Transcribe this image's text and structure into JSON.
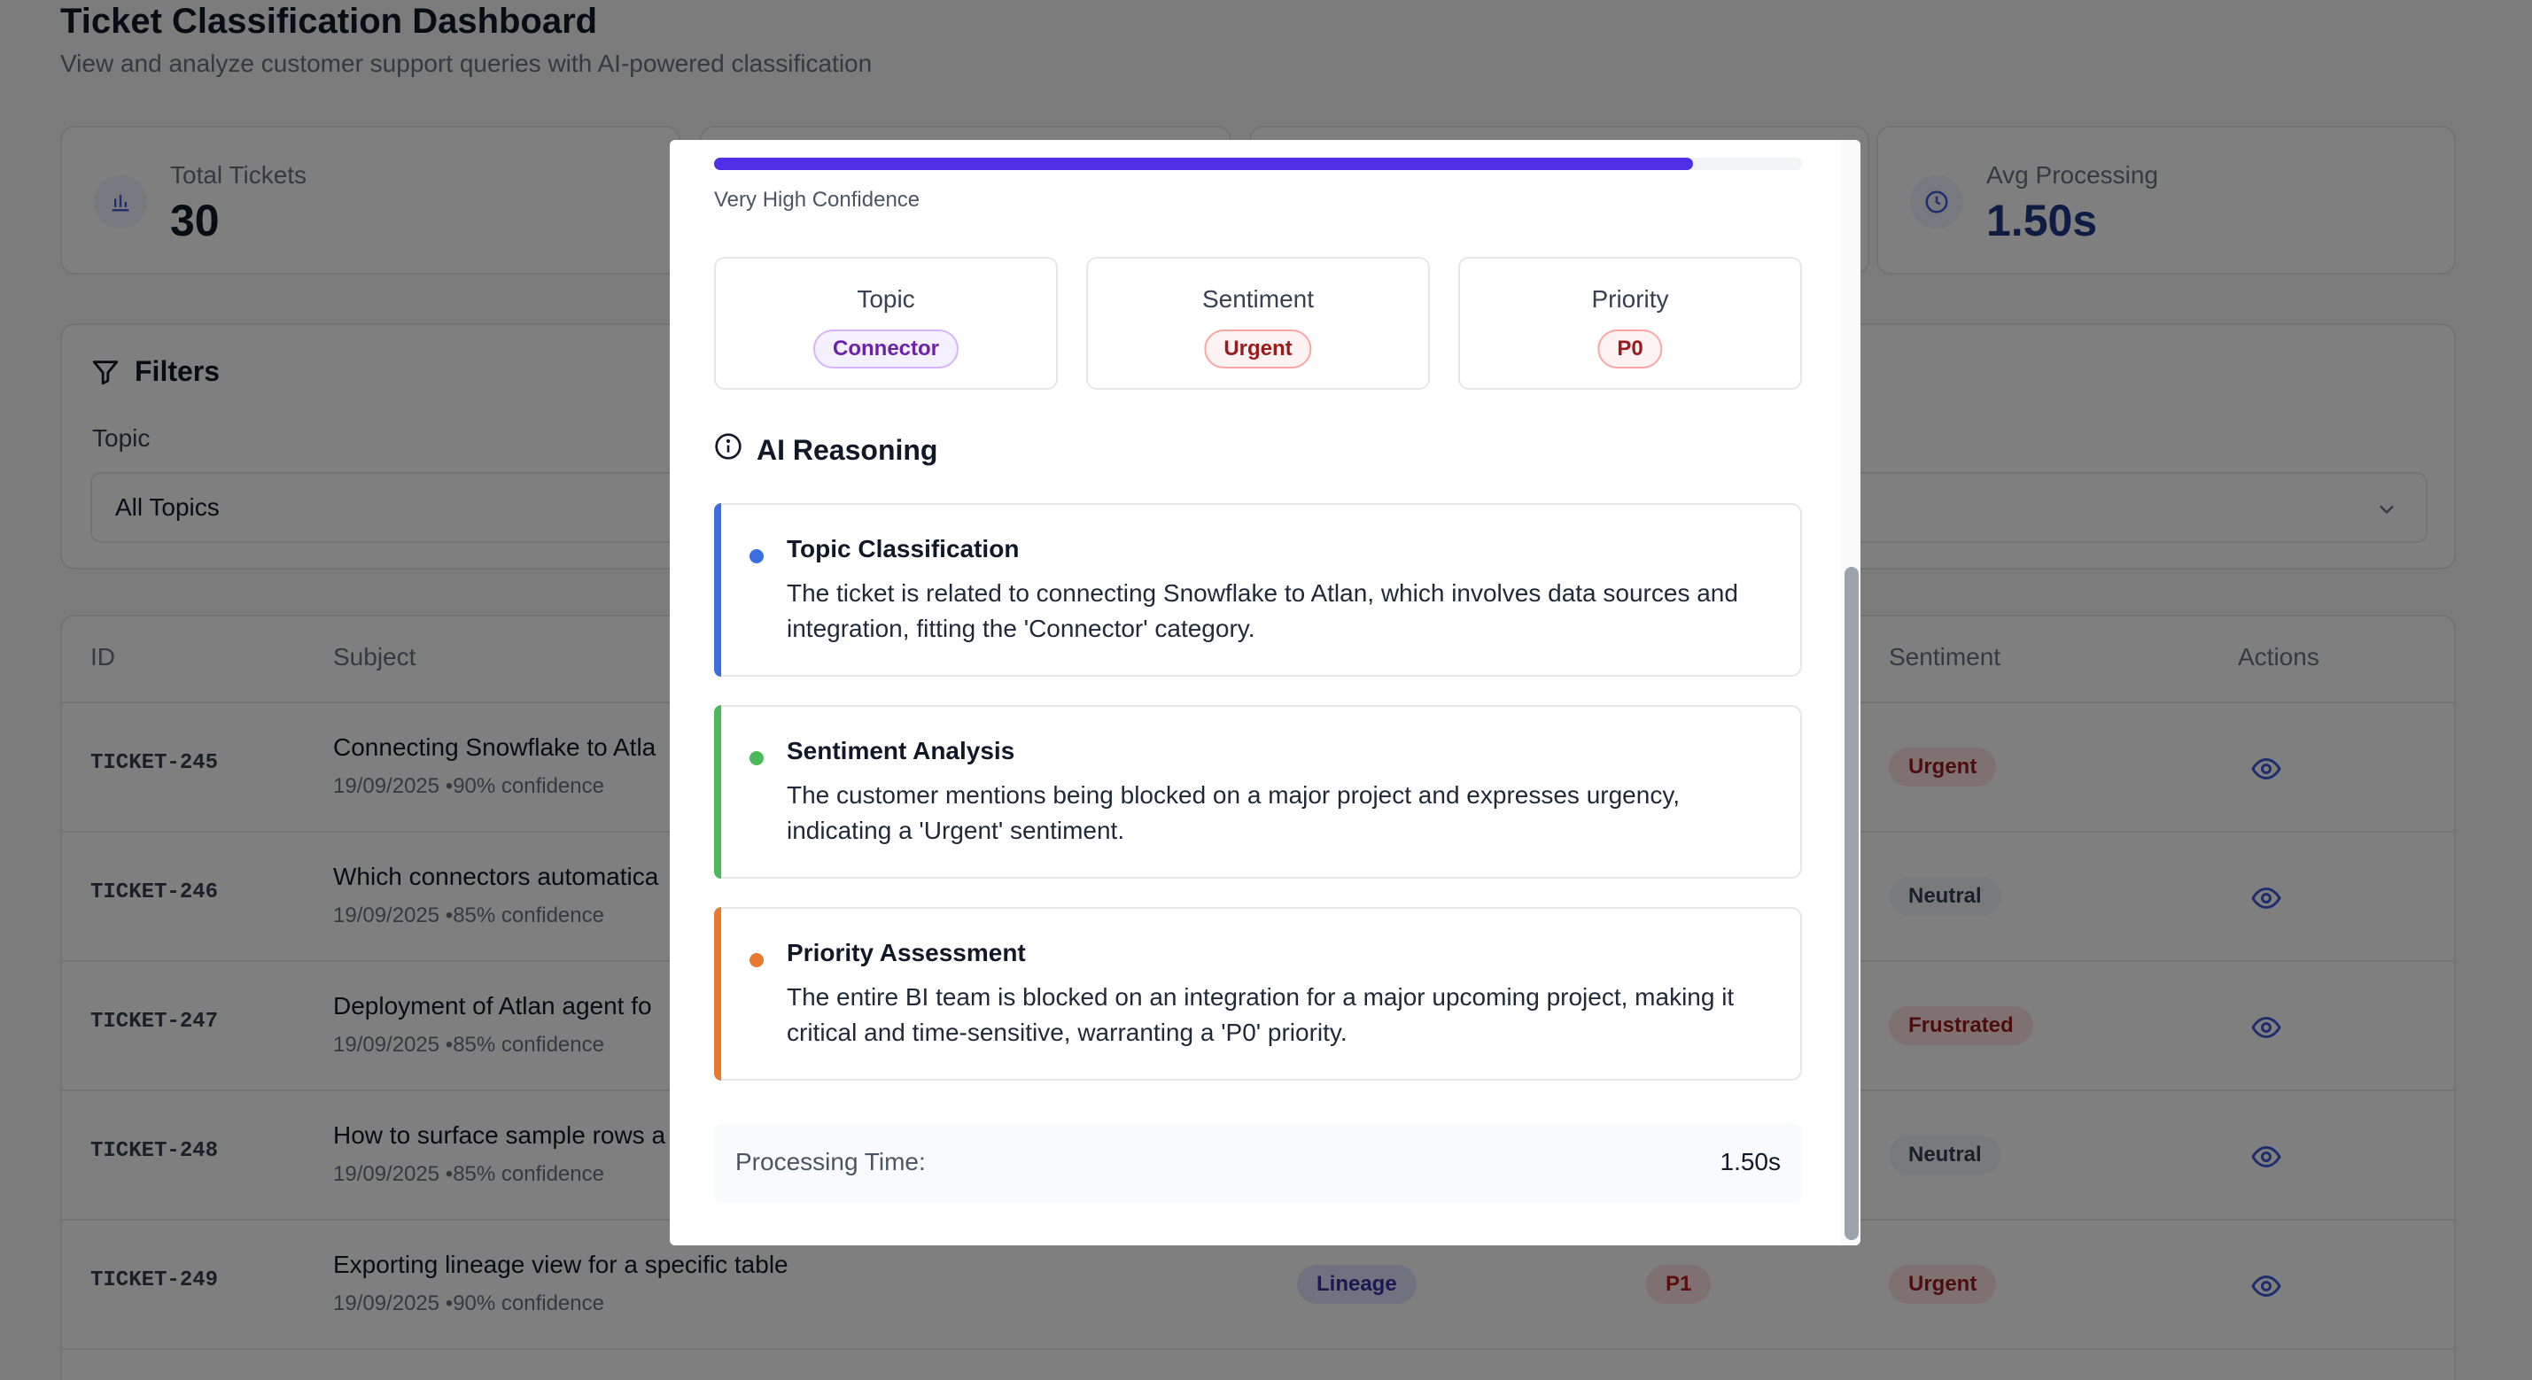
{
  "dashboard": {
    "title": "Ticket Classification Dashboard",
    "subtitle": "View and analyze customer support queries with AI-powered classification",
    "stats": {
      "total_tickets": {
        "label": "Total Tickets",
        "value": "30",
        "icon": "bar-chart-icon"
      },
      "avg_processing": {
        "label": "Avg Processing",
        "value": "1.50s",
        "icon": "clock-icon"
      }
    },
    "filters": {
      "title": "Filters",
      "topic_label": "Topic",
      "topic_value": "All Topics"
    },
    "table": {
      "headers": {
        "id": "ID",
        "subject": "Subject",
        "sentiment": "Sentiment",
        "actions": "Actions"
      },
      "rows": [
        {
          "id": "TICKET-245",
          "subject": "Connecting Snowflake to Atla",
          "meta": "19/09/2025 •90% confidence",
          "sentiment": "Urgent"
        },
        {
          "id": "TICKET-246",
          "subject": "Which connectors automatica",
          "meta": "19/09/2025 •85% confidence",
          "sentiment": "Neutral"
        },
        {
          "id": "TICKET-247",
          "subject": "Deployment of Atlan agent fo",
          "meta": "19/09/2025 •85% confidence",
          "sentiment": "Frustrated"
        },
        {
          "id": "TICKET-248",
          "subject": "How to surface sample rows a",
          "meta": "19/09/2025 •85% confidence",
          "sentiment": "Neutral"
        },
        {
          "id": "TICKET-249",
          "subject": "Exporting lineage view for a specific table",
          "meta": "19/09/2025 •90% confidence",
          "topic": "Lineage",
          "priority": "P1",
          "sentiment": "Urgent"
        }
      ]
    }
  },
  "modal": {
    "confidence": {
      "fraction": 0.9,
      "label": "Very High Confidence",
      "color": "#4f2fe6"
    },
    "cards": {
      "topic": {
        "label": "Topic",
        "value": "Connector"
      },
      "sentiment": {
        "label": "Sentiment",
        "value": "Urgent"
      },
      "priority": {
        "label": "Priority",
        "value": "P0"
      }
    },
    "ai_reasoning": {
      "title": "AI Reasoning",
      "items": [
        {
          "title": "Topic Classification",
          "text": "The ticket is related to connecting Snowflake to Atlan, which involves data sources and integration, fitting the 'Connector' category.",
          "color": "#3b6fe0"
        },
        {
          "title": "Sentiment Analysis",
          "text": "The customer mentions being blocked on a major project and expresses urgency, indicating a 'Urgent' sentiment.",
          "color": "#4cb85c"
        },
        {
          "title": "Priority Assessment",
          "text": "The entire BI team is blocked on an integration for a major upcoming project, making it critical and time-sensitive, warranting a 'P0' priority.",
          "color": "#e8792f"
        }
      ]
    },
    "processing": {
      "label": "Processing Time:",
      "value": "1.50s"
    }
  }
}
